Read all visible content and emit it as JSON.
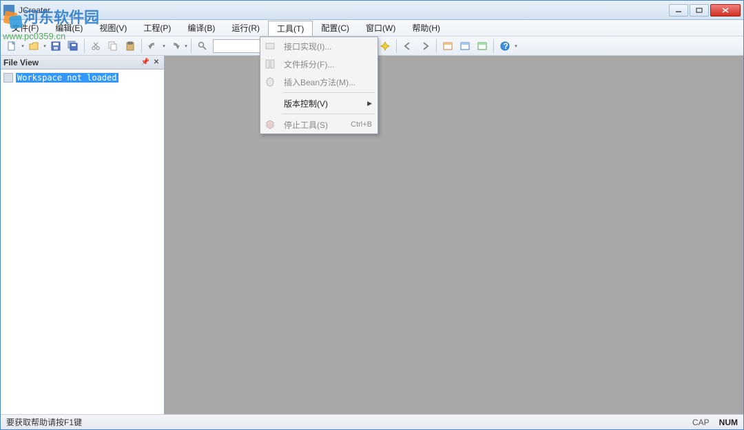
{
  "window": {
    "title": "JCreator"
  },
  "menubar": {
    "file": "文件(F)",
    "edit": "编辑(E)",
    "view": "视图(V)",
    "project": "工程(P)",
    "build": "编译(B)",
    "run": "运行(R)",
    "tools": "工具(T)",
    "configure": "配置(C)",
    "window": "窗口(W)",
    "help": "帮助(H)"
  },
  "dropdown": {
    "item0": "接口实现(I)...",
    "item1": "文件拆分(F)...",
    "item2": "插入Bean方法(M)...",
    "item3": "版本控制(V)",
    "item4": "停止工具(S)",
    "shortcut4": "Ctrl+B"
  },
  "sidebar": {
    "title": "File View",
    "node0": "Workspace not loaded"
  },
  "status": {
    "help": "要获取帮助请按F1键",
    "cap": "CAP",
    "num": "NUM"
  },
  "watermark": {
    "line1": "河东软件园",
    "line2": "www.pc0359.cn"
  }
}
